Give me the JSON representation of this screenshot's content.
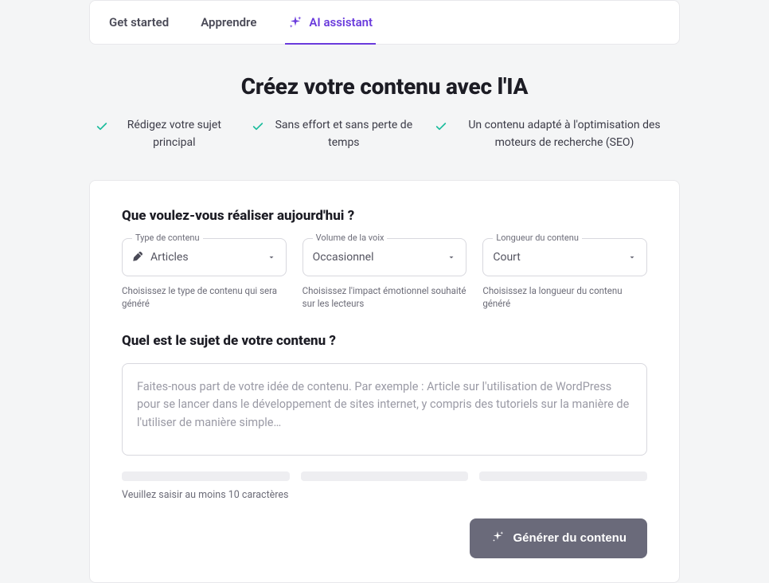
{
  "tabs": {
    "get_started": "Get started",
    "learn": "Apprendre",
    "ai_assistant": "AI assistant"
  },
  "hero": {
    "title": "Créez votre contenu avec l'IA",
    "benefits": [
      "Rédigez votre sujet principal",
      "Sans effort et sans perte de temps",
      "Un contenu adapté à l'optimisation des moteurs de recherche (SEO)"
    ]
  },
  "form": {
    "question_goal": "Que voulez-vous réaliser aujourd'hui ?",
    "content_type": {
      "label": "Type de contenu",
      "value": "Articles",
      "helper": "Choisissez le type de contenu qui sera généré"
    },
    "voice": {
      "label": "Volume de la voix",
      "value": "Occasionnel",
      "helper": "Choisissez l'impact émotionnel souhaité sur les lecteurs"
    },
    "length": {
      "label": "Longueur du contenu",
      "value": "Court",
      "helper": "Choisissez la longueur du contenu généré"
    },
    "question_topic": "Quel est le sujet de votre contenu ?",
    "topic_placeholder": "Faites-nous part de votre idée de contenu. Par exemple : Article sur l'utilisation de WordPress pour se lancer dans le développement de sites internet, y compris des tutoriels sur la manière de l'utiliser de manière simple…",
    "min_chars_hint": "Veuillez saisir au moins 10 caractères",
    "generate_label": "Générer du contenu"
  }
}
